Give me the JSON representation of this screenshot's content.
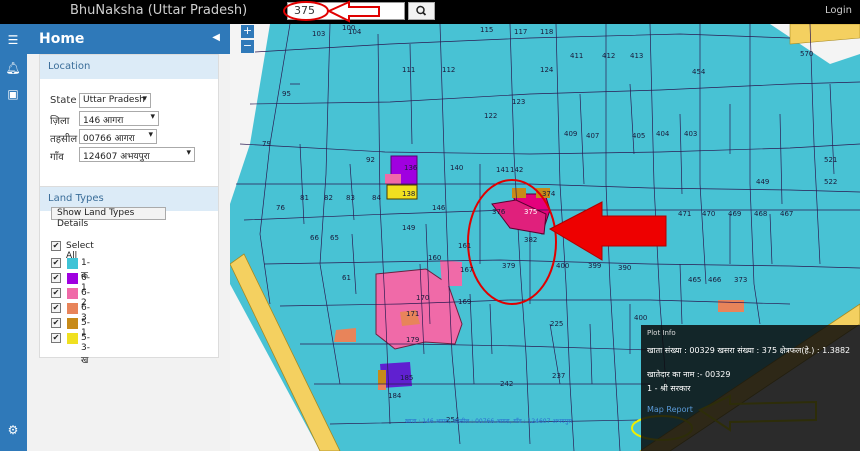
{
  "topbar": {
    "app_title": "BhuNaksha (Uttar Pradesh)",
    "search_value": "375",
    "login_label": "Login"
  },
  "sidebar": {
    "home_title": "Home",
    "location": {
      "heading": "Location",
      "state_label": "State",
      "state_value": "Uttar Pradesh",
      "district_label": "ज़िला",
      "district_value": "146 आगरा",
      "tehsil_label": "तहसील",
      "tehsil_value": "00766 आगरा",
      "village_label": "गाँव",
      "village_value": "124607 अभयपुरा"
    },
    "land_types": {
      "heading": "Land Types",
      "button_label": "Show Land Types Details",
      "select_all_label": "Select All",
      "items": [
        {
          "label": "1-क",
          "color": "#3ec3d6"
        },
        {
          "label": "6-1",
          "color": "#a000e0"
        },
        {
          "label": "6-2",
          "color": "#f06aa8"
        },
        {
          "label": "6-3",
          "color": "#e8845a"
        },
        {
          "label": "5-1",
          "color": "#c78a18"
        },
        {
          "label": "5-3-ख",
          "color": "#f0e020"
        }
      ]
    }
  },
  "map": {
    "highlighted_plot": "375",
    "plot_numbers": [
      {
        "n": "103"
      },
      {
        "n": "104"
      },
      {
        "n": "100"
      },
      {
        "n": "115"
      },
      {
        "n": "117"
      },
      {
        "n": "118"
      },
      {
        "n": "111"
      },
      {
        "n": "112"
      },
      {
        "n": "413"
      },
      {
        "n": "411"
      },
      {
        "n": "412"
      },
      {
        "n": "454"
      },
      {
        "n": "95"
      },
      {
        "n": "122"
      },
      {
        "n": "124"
      },
      {
        "n": "123"
      },
      {
        "n": "409"
      },
      {
        "n": "407"
      },
      {
        "n": "405"
      },
      {
        "n": "404"
      },
      {
        "n": "403"
      },
      {
        "n": "140"
      },
      {
        "n": "141"
      },
      {
        "n": "142"
      },
      {
        "n": "136"
      },
      {
        "n": "138"
      },
      {
        "n": "146"
      },
      {
        "n": "149"
      },
      {
        "n": "375"
      },
      {
        "n": "374"
      },
      {
        "n": "376"
      },
      {
        "n": "382"
      },
      {
        "n": "379"
      },
      {
        "n": "400"
      },
      {
        "n": "399"
      },
      {
        "n": "390"
      },
      {
        "n": "170"
      },
      {
        "n": "169"
      },
      {
        "n": "171"
      },
      {
        "n": "179"
      },
      {
        "n": "185"
      },
      {
        "n": "225"
      },
      {
        "n": "242"
      },
      {
        "n": "237"
      },
      {
        "n": "449"
      },
      {
        "n": "471"
      },
      {
        "n": "470"
      },
      {
        "n": "469"
      },
      {
        "n": "468"
      },
      {
        "n": "467"
      },
      {
        "n": "521"
      },
      {
        "n": "522"
      },
      {
        "n": "79"
      },
      {
        "n": "76"
      },
      {
        "n": "81"
      },
      {
        "n": "82"
      },
      {
        "n": "83"
      },
      {
        "n": "84"
      },
      {
        "n": "66"
      },
      {
        "n": "65"
      },
      {
        "n": "61"
      },
      {
        "n": "92"
      },
      {
        "n": "160"
      },
      {
        "n": "161"
      },
      {
        "n": "167"
      },
      {
        "n": "184"
      },
      {
        "n": "254"
      },
      {
        "n": "400"
      },
      {
        "n": "570"
      },
      {
        "n": "373"
      },
      {
        "n": "466"
      },
      {
        "n": "465"
      }
    ]
  },
  "plot_info": {
    "title": "Plot Info",
    "line1": "खाता संख्या : 00329 खसरा संख्या : 375 क्षेत्रफल(हे.) : 1.3882",
    "line2": "खातेदार का नाम :- 00329",
    "line3": "1 - श्री सरकार",
    "map_report_label": "Map Report"
  },
  "bottom_text": "खाता : 146 आगरा, तहसील : 00766 आगरा, गाँव : 124607 अभयपुरा"
}
